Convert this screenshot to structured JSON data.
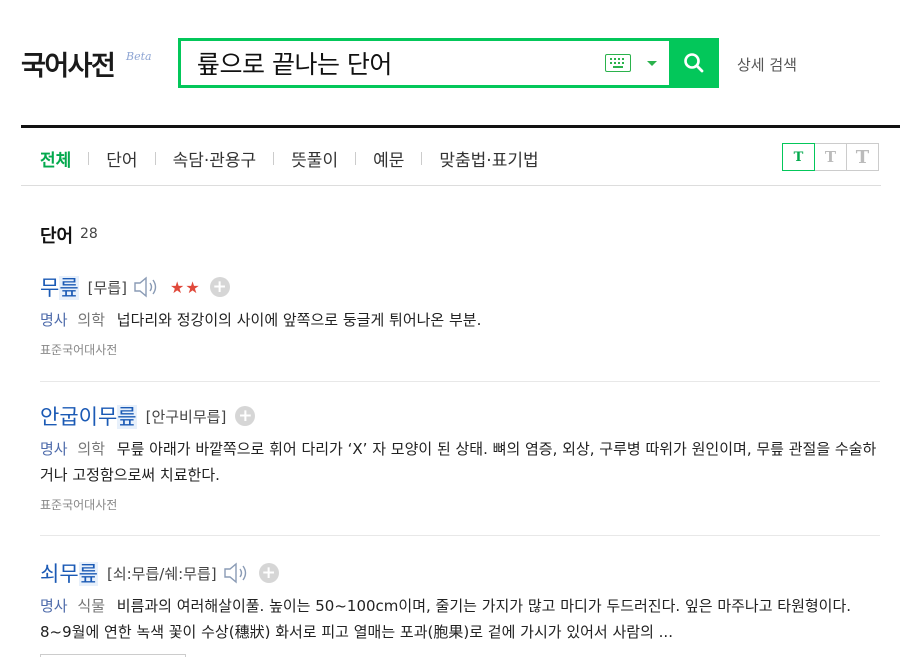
{
  "header": {
    "logo": "국어사전",
    "logo_badge": "Beta",
    "search_value": "륲으로 끝나는 단어",
    "detail_search": "상세 검색"
  },
  "tabs": [
    {
      "label": "전체",
      "active": true
    },
    {
      "label": "단어",
      "active": false
    },
    {
      "label": "속담·관용구",
      "active": false
    },
    {
      "label": "뜻풀이",
      "active": false
    },
    {
      "label": "예문",
      "active": false
    },
    {
      "label": "맞춤법·표기법",
      "active": false
    }
  ],
  "font_size_buttons": [
    "T",
    "T",
    "T"
  ],
  "section": {
    "title": "단어",
    "count": "28"
  },
  "entries": [
    {
      "word_prefix": "무",
      "word_highlight": "릎",
      "pronunciation": "[무릅]",
      "stars": "★★",
      "pos": "명사",
      "field": "의학",
      "definition": "넙다리와 정강이의 사이에 앞쪽으로 둥글게 튀어나온 부분.",
      "source": "표준국어대사전"
    },
    {
      "word_prefix": "안굽이무",
      "word_highlight": "릎",
      "pronunciation": "[안구비무릅]",
      "pos": "명사",
      "field": "의학",
      "definition": "무릎 아래가 바깥쪽으로 휘어 다리가 ‘X’ 자 모양이 된 상태. 뼈의 염증, 외상, 구루병 따위가 원인이며, 무릎 관절을 수술하거나 고정함으로써 치료한다.",
      "source": "표준국어대사전"
    },
    {
      "word_prefix": "쇠무",
      "word_highlight": "릎",
      "pronunciation": "[쇠:무릅/쉐:무릅]",
      "pos": "명사",
      "field": "식물",
      "definition": "비름과의 여러해살이풀. 높이는 50~100cm이며, 줄기는 가지가 많고 마디가 두드러진다. 잎은 마주나고 타원형이다. 8~9월에 연한 녹색 꽃이 수상(穗狀) 화서로 피고 열매는 포과(胞果)로 겉에 가시가 있어서 사람의 ..."
    }
  ],
  "colors": {
    "accent": "#03c75a",
    "link": "#1b5ab5",
    "star": "#e0493b"
  }
}
